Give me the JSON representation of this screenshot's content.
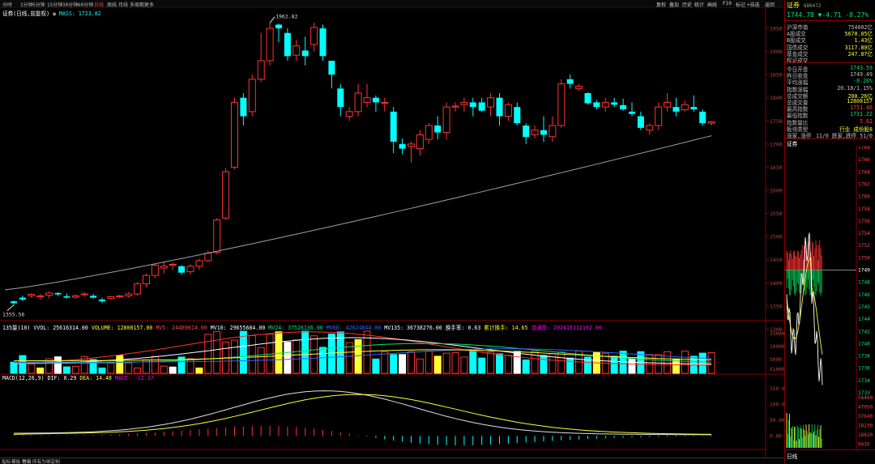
{
  "toolbar": {
    "periods": [
      "分时",
      "1分钟",
      "5分钟",
      "15分钟",
      "30分钟",
      "60分钟",
      "日线",
      "周线",
      "月线",
      "多周期",
      "更多"
    ],
    "active_period": "日线",
    "right_tools": [
      "复权",
      "叠加",
      "历史",
      "统计",
      "画线",
      "F10",
      "标记",
      "+自选",
      "返回"
    ]
  },
  "main_legend": {
    "name": "证券(日线,前复权)",
    "mass": "MASS: 1723.82"
  },
  "annotations": {
    "high": "1962.82",
    "low": "1355.56"
  },
  "price_axis": [
    "1950",
    "1900",
    "1850",
    "1800",
    "1750",
    "1700",
    "1650",
    "1600",
    "1550",
    "1500",
    "1450",
    "1400",
    "1350",
    "1300"
  ],
  "volume_legend": {
    "title": "135量(10)",
    "vvol": "VVOL: 25616314.00",
    "volume": "VOLUME: 12808157.00",
    "mv5": "MV5: 24489614.00",
    "mv10": "MV10: 29655684.00",
    "mv24": "MV24: 37526136.00",
    "mv60": "MV60: 42624844.00",
    "mv135": "MV135: 36738276.00",
    "turnover": "换手率: 0.63",
    "cum_turnover": "累计换手: 14.65",
    "float": "流通盘: 2024151121",
    "float_tail": "92.00"
  },
  "volume_axis": [
    "15000",
    "10000",
    "5000",
    "X10000"
  ],
  "macd_legend": {
    "title": "MACD(12,26,9)",
    "dif": "DIF: 8.29",
    "dea": "DEA: 14.48",
    "macd": "MACD: -12.37"
  },
  "macd_axis": [
    "150.0",
    "100.0",
    "50.00",
    "0.00"
  ],
  "chart_data": {
    "type": "candlestick",
    "candles": [
      [
        1360,
        1362,
        1352,
        1356
      ],
      [
        1368,
        1372,
        1360,
        1364
      ],
      [
        1372,
        1378,
        1368,
        1375
      ],
      [
        1370,
        1376,
        1364,
        1372
      ],
      [
        1373,
        1382,
        1366,
        1378
      ],
      [
        1378,
        1380,
        1372,
        1375
      ],
      [
        1371,
        1377,
        1366,
        1368
      ],
      [
        1369,
        1375,
        1366,
        1372
      ],
      [
        1374,
        1380,
        1370,
        1376
      ],
      [
        1372,
        1376,
        1366,
        1368
      ],
      [
        1364,
        1368,
        1356,
        1360
      ],
      [
        1366,
        1372,
        1364,
        1370
      ],
      [
        1370,
        1374,
        1366,
        1372
      ],
      [
        1372,
        1380,
        1368,
        1376
      ],
      [
        1376,
        1402,
        1372,
        1398
      ],
      [
        1398,
        1420,
        1390,
        1416
      ],
      [
        1416,
        1442,
        1410,
        1438
      ],
      [
        1432,
        1446,
        1420,
        1436
      ],
      [
        1438,
        1444,
        1428,
        1440
      ],
      [
        1436,
        1438,
        1418,
        1422
      ],
      [
        1424,
        1440,
        1418,
        1436
      ],
      [
        1436,
        1452,
        1428,
        1448
      ],
      [
        1448,
        1470,
        1444,
        1464
      ],
      [
        1466,
        1540,
        1462,
        1536
      ],
      [
        1540,
        1648,
        1536,
        1640
      ],
      [
        1650,
        1800,
        1645,
        1790
      ],
      [
        1800,
        1810,
        1740,
        1760
      ],
      [
        1770,
        1850,
        1760,
        1840
      ],
      [
        1840,
        1940,
        1835,
        1880
      ],
      [
        1880,
        1962,
        1870,
        1950
      ],
      [
        1958,
        1960,
        1920,
        1950
      ],
      [
        1940,
        1950,
        1880,
        1890
      ],
      [
        1892,
        1925,
        1880,
        1912
      ],
      [
        1902,
        1932,
        1870,
        1890
      ],
      [
        1915,
        1962,
        1900,
        1952
      ],
      [
        1950,
        1958,
        1880,
        1890
      ],
      [
        1880,
        1880,
        1820,
        1850
      ],
      [
        1820,
        1830,
        1760,
        1780
      ],
      [
        1760,
        1780,
        1750,
        1770
      ],
      [
        1770,
        1830,
        1760,
        1810
      ],
      [
        1790,
        1830,
        1780,
        1800
      ],
      [
        1800,
        1805,
        1770,
        1790
      ],
      [
        1790,
        1800,
        1770,
        1790
      ],
      [
        1770,
        1780,
        1680,
        1705
      ],
      [
        1700,
        1712,
        1678,
        1690
      ],
      [
        1695,
        1705,
        1660,
        1700
      ],
      [
        1690,
        1730,
        1675,
        1720
      ],
      [
        1710,
        1745,
        1700,
        1740
      ],
      [
        1740,
        1760,
        1710,
        1725
      ],
      [
        1725,
        1790,
        1710,
        1780
      ],
      [
        1780,
        1790,
        1770,
        1782
      ],
      [
        1785,
        1800,
        1770,
        1790
      ],
      [
        1790,
        1800,
        1760,
        1780
      ],
      [
        1790,
        1800,
        1770,
        1772
      ],
      [
        1780,
        1810,
        1760,
        1800
      ],
      [
        1800,
        1810,
        1740,
        1760
      ],
      [
        1760,
        1790,
        1750,
        1785
      ],
      [
        1780,
        1790,
        1740,
        1745
      ],
      [
        1740,
        1745,
        1700,
        1715
      ],
      [
        1720,
        1740,
        1712,
        1730
      ],
      [
        1730,
        1760,
        1705,
        1720
      ],
      [
        1716,
        1760,
        1705,
        1740
      ],
      [
        1740,
        1840,
        1735,
        1830
      ],
      [
        1840,
        1850,
        1820,
        1830
      ],
      [
        1820,
        1830,
        1815,
        1825
      ],
      [
        1810,
        1812,
        1785,
        1788
      ],
      [
        1790,
        1795,
        1775,
        1780
      ],
      [
        1780,
        1800,
        1770,
        1790
      ],
      [
        1790,
        1800,
        1780,
        1785
      ],
      [
        1784,
        1798,
        1772,
        1775
      ],
      [
        1770,
        1790,
        1760,
        1765
      ],
      [
        1760,
        1770,
        1730,
        1735
      ],
      [
        1730,
        1745,
        1720,
        1740
      ],
      [
        1740,
        1790,
        1730,
        1780
      ],
      [
        1780,
        1810,
        1770,
        1790
      ],
      [
        1780,
        1800,
        1760,
        1770
      ],
      [
        1774,
        1794,
        1770,
        1785
      ],
      [
        1780,
        1805,
        1770,
        1775
      ],
      [
        1770,
        1775,
        1740,
        1745
      ],
      [
        1745,
        1750,
        1740,
        1748
      ]
    ],
    "ma_start": 1385,
    "ma_end": 1718
  },
  "right_panel": {
    "name": "证券",
    "code": "880472",
    "price": "1744.78",
    "change": "▼-4.71",
    "pct": "-0.27%",
    "rows": [
      {
        "k": "沪深市值",
        "v": "754002亿",
        "c": ""
      },
      {
        "k": "A股成交",
        "v": "5670.05亿",
        "c": "yellow"
      },
      {
        "k": "B股成交",
        "v": "1.43亿",
        "c": "yellow"
      },
      {
        "k": "国债成交",
        "v": "3117.80亿",
        "c": "yellow"
      },
      {
        "k": "基金成交",
        "v": "247.87亿",
        "c": "yellow"
      },
      {
        "k": "权证成交",
        "v": "",
        "c": ""
      },
      {
        "k": "今日开盘",
        "v": "1743.59",
        "c": "green"
      },
      {
        "k": "昨日收盘",
        "v": "1749.49",
        "c": ""
      },
      {
        "k": "平均涨幅",
        "v": "-0.20%",
        "c": "green"
      },
      {
        "k": "指数涨幅",
        "v": "20.18/1.15%",
        "c": ""
      },
      {
        "k": "总成交额",
        "v": "200.26亿",
        "c": "yellow"
      },
      {
        "k": "总成交量",
        "v": "12808157",
        "c": "yellow"
      },
      {
        "k": "最高指数",
        "v": "1751.46",
        "c": "red"
      },
      {
        "k": "最低指数",
        "v": "1731.22",
        "c": "green"
      },
      {
        "k": "指数量比",
        "v": "5.62",
        "c": "red"
      },
      {
        "k": "板块类型",
        "v": "行业 成份股8",
        "c": "yellow"
      },
      {
        "k": "涨家,涨停",
        "v": "11/0 跌家,跌停 51/0",
        "c": ""
      }
    ],
    "intraday_label": "证券",
    "intraday_axis": [
      "1768",
      "1766",
      "1764",
      "1762",
      "1760",
      "1758",
      "1756",
      "1754",
      "1752",
      "1750",
      "1749",
      "1748",
      "1746",
      "1745",
      "1744",
      "1742",
      "1740",
      "1738",
      "1736",
      "1734",
      "1733"
    ],
    "vol_axis": [
      "56460",
      "47050",
      "37640",
      "28230",
      "18820",
      "9410"
    ],
    "bottom_tab": "日线"
  },
  "bottom_tabs": [
    "指标",
    "模板",
    "常用",
    "所有为",
    "绑定制"
  ],
  "colors": {
    "up": "#ff3232",
    "down": "#00ffff",
    "ma": "#a0a0a0",
    "bg": "#000000"
  }
}
